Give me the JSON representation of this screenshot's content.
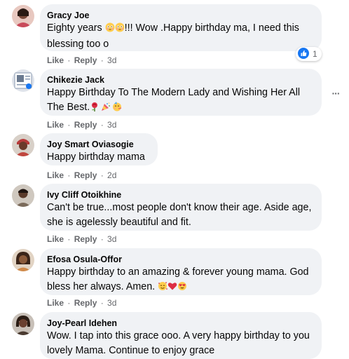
{
  "comments": [
    {
      "name": "Gracy Joe",
      "text_before": "Eighty years ",
      "text_after": "!!! Wow .Happy birthday ma, I need this blessing too o",
      "emojis": [
        "flushed-face",
        "flushed-face"
      ],
      "like": "Like",
      "reply": "Reply",
      "time": "3d",
      "reaction_count": "1",
      "reaction_icon": "like-icon",
      "avatar_color": "#c94a5a"
    },
    {
      "name": "Chikezie Jack",
      "text": "Happy Birthday To The Modern Lady and Wishing Her All The Best.",
      "emojis": [
        "rose",
        "party-popper",
        "partying-face"
      ],
      "like": "Like",
      "reply": "Reply",
      "time": "3d",
      "more_icon": "more-options-icon",
      "avatar_color": "#8a9ab0"
    },
    {
      "name": "Joy Smart Oviasogie",
      "text": "Happy birthday mama",
      "like": "Like",
      "reply": "Reply",
      "time": "2d",
      "avatar_color": "#b83a3a"
    },
    {
      "name": "Ivy Cliff Otoikhine",
      "text": "Can't be true...most people don't know their age. Aside age, she is agelessly beautiful and fit.",
      "like": "Like",
      "reply": "Reply",
      "time": "3d",
      "avatar_color": "#9a8a7a"
    },
    {
      "name": "Efosa Osula-Offor",
      "text": "Happy birthday to an amazing & forever young mama. God bless her always. Amen.",
      "emojis": [
        "smiling-face-with-hearts",
        "red-heart",
        "heart-eyes"
      ],
      "like": "Like",
      "reply": "Reply",
      "time": "3d",
      "avatar_color": "#a86a4a"
    },
    {
      "name": "Joy-Pearl Idehen",
      "text": "Wow. I tap into this grace ooo. A very happy birthday to you lovely Mama. Continue to enjoy grace",
      "avatar_color": "#6a5a4a"
    }
  ],
  "colors": {
    "bubble": "#f0f2f5",
    "secondary_text": "#65676b",
    "like_blue": "#1877f2"
  }
}
